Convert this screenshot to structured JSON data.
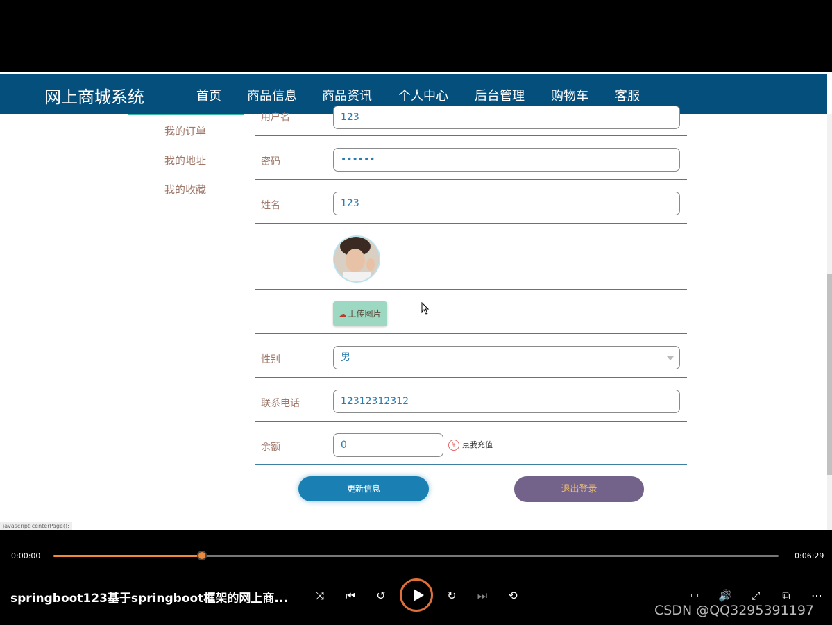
{
  "header": {
    "brand": "网上商城系统",
    "nav": [
      "首页",
      "商品信息",
      "商品资讯",
      "个人中心",
      "后台管理",
      "购物车",
      "客服"
    ],
    "active_nav": "个人中心"
  },
  "sidebar": {
    "items": [
      "我的订单",
      "我的地址",
      "我的收藏"
    ]
  },
  "form": {
    "username_label": "用户名",
    "username_value": "123",
    "password_label": "密码",
    "password_value": "••••••",
    "name_label": "姓名",
    "name_value": "123",
    "upload_label": "上传图片",
    "gender_label": "性别",
    "gender_value": "男",
    "phone_label": "联系电话",
    "phone_value": "12312312312",
    "balance_label": "余额",
    "balance_value": "0",
    "recharge_label": "点我充值",
    "update_button": "更新信息",
    "logout_button": "退出登录"
  },
  "status_bar": {
    "url": "javascript:centerPage();"
  },
  "player": {
    "current_time": "0:00:00",
    "total_time": "0:06:29",
    "progress": 0.205,
    "title": "springboot123基于springboot框架的网上商...",
    "accent_color": "#f08a3a"
  },
  "watermark": "CSDN @QQ3295391197"
}
